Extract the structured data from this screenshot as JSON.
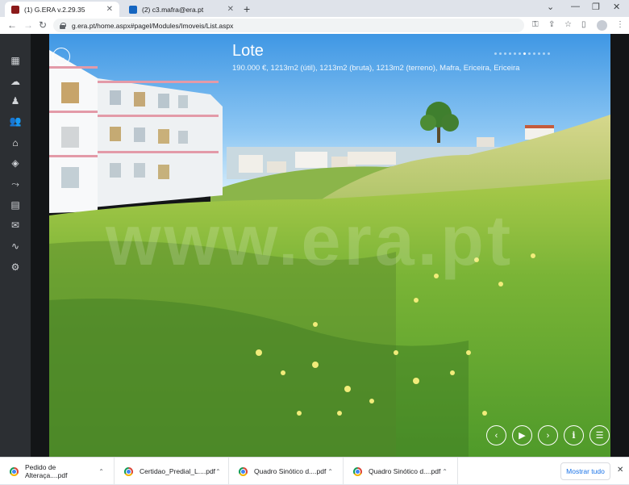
{
  "browser": {
    "tabs": [
      {
        "title": "(1) G.ERA v.2.29.35",
        "active": true,
        "favicon_color": "#8b1a1a"
      },
      {
        "title": "(2) c3.mafra@era.pt",
        "active": false,
        "favicon_color": "#1565c0"
      }
    ],
    "new_tab_label": "+",
    "address": "g.era.pt/home.aspx#pagel/Modules/Imoveis/List.aspx",
    "icons": [
      "key-icon",
      "share-icon",
      "star-icon",
      "sidepanel-icon",
      "profile-icon",
      "menu-icon"
    ]
  },
  "sidebar": {
    "items": [
      {
        "name": "grid-icon",
        "glyph": "▦"
      },
      {
        "name": "chat-icon",
        "glyph": "☁"
      },
      {
        "name": "person-walking-icon",
        "glyph": "♟"
      },
      {
        "name": "users-icon",
        "glyph": "👥"
      },
      {
        "name": "home-icon",
        "glyph": "⌂",
        "active": true
      },
      {
        "name": "layers-icon",
        "glyph": "◈"
      },
      {
        "name": "route-icon",
        "glyph": "⤳"
      },
      {
        "name": "card-icon",
        "glyph": "▤"
      },
      {
        "name": "mail-icon",
        "glyph": "✉"
      },
      {
        "name": "chart-icon",
        "glyph": "∿"
      },
      {
        "name": "settings-icon",
        "glyph": "⚙"
      }
    ]
  },
  "listing": {
    "title": "Lote",
    "subtitle": "190.000 €, 1213m2 (útil), 1213m2 (bruta), 1213m2 (terreno), Mafra, Ericeira, Ericeira",
    "watermark": "www.era.pt",
    "slide_count": 12,
    "active_slide": 6
  },
  "controls": {
    "back": "←",
    "prev": "‹",
    "play": "▶",
    "next": "›",
    "info": "i",
    "list": "☰"
  },
  "downloads": {
    "items": [
      {
        "label": "Pedido de Alteraça....pdf"
      },
      {
        "label": "Certidao_Predial_L....pdf"
      },
      {
        "label": "Quadro Sinótico d....pdf"
      },
      {
        "label": "Quadro Sinótico d....pdf"
      }
    ],
    "show_all": "Mostrar tudo",
    "close": "✕"
  }
}
